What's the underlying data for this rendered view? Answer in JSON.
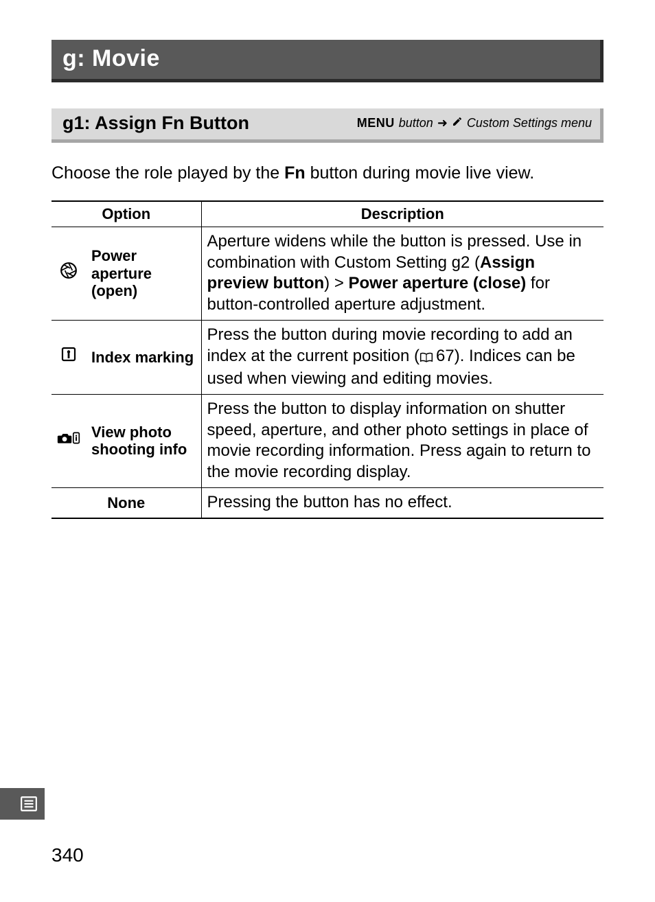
{
  "section_title": "g: Movie",
  "setting_title": "g1: Assign Fn Button",
  "breadcrumb": {
    "menu_label": "MENU",
    "button_word": "button",
    "target": "Custom Settings menu"
  },
  "intro": {
    "pre": "Choose the role played by the ",
    "bold": "Fn",
    "post": " button during movie live view."
  },
  "table": {
    "headers": {
      "option": "Option",
      "description": "Description"
    },
    "rows": [
      {
        "icon": "aperture-icon",
        "label": "Power aperture (open)",
        "desc_parts": [
          {
            "t": "Aperture widens while the button is pressed.  Use in combination with Custom Setting g2 ("
          },
          {
            "b": "Assign preview button"
          },
          {
            "t": ") > "
          },
          {
            "b": "Power aperture (close)"
          },
          {
            "t": " for button-controlled aperture adjustment."
          }
        ]
      },
      {
        "icon": "index-marking-icon",
        "label": "Index marking",
        "desc_parts": [
          {
            "t": "Press the button during movie recording to add an index at the current position ("
          },
          {
            "ref": "67"
          },
          {
            "t": ").  Indices can be used when viewing and editing movies."
          }
        ]
      },
      {
        "icon": "camera-info-icon",
        "label": "View photo shooting info",
        "desc_parts": [
          {
            "t": "Press the button to display information on shutter speed, aperture, and other photo settings in place of movie recording information.  Press again to return to the movie recording display."
          }
        ]
      },
      {
        "icon": "",
        "label": "None",
        "label_center": true,
        "span_two": true,
        "desc_parts": [
          {
            "t": "Pressing the button has no effect."
          }
        ]
      }
    ]
  },
  "page_number": "340"
}
